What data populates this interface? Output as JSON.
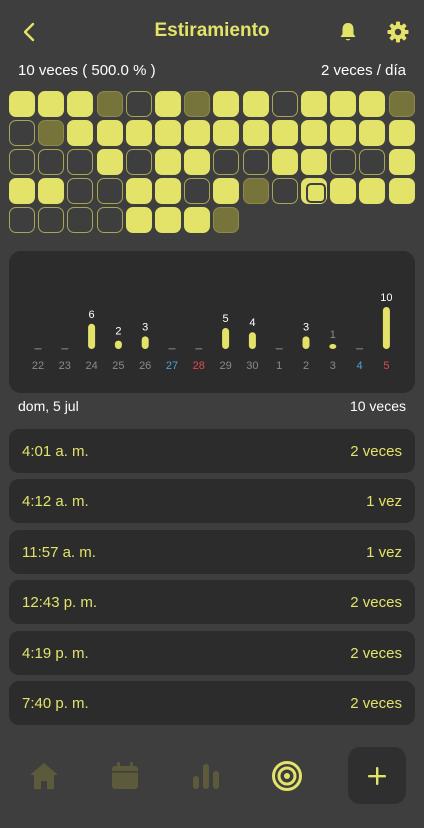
{
  "header": {
    "title": "Estiramiento",
    "back_icon": "chevron-left-icon",
    "bell_icon": "bell-icon",
    "settings_icon": "gear-icon"
  },
  "stats": {
    "count": "10 veces  ( 500.0 % )",
    "goal": "2 veces / día"
  },
  "colors": {
    "accent": "#e3e36a",
    "background": "#3e3e3e",
    "card": "#2c2c2c",
    "dim": "#76743a",
    "weekend_blue": "#4aa3df",
    "weekend_red": "#e04a4a",
    "muted_label": "#8a8a8a"
  },
  "streak_grid": {
    "legend": "F=full, D=partial, E=empty, T=today",
    "rows": [
      "FFFDEFDFFEFFFD",
      "EDFFFFFFFFFFFF",
      "EEEFEFFEEFFEEF",
      "FFEEFFEFDEEFFF",
      "EEEEFFFD"
    ],
    "today": {
      "row": 3,
      "col": 10
    }
  },
  "chart_data": {
    "type": "bar",
    "categories": [
      "22",
      "23",
      "24",
      "25",
      "26",
      "27",
      "28",
      "29",
      "30",
      "1",
      "2",
      "3",
      "4",
      "5"
    ],
    "values": [
      0,
      0,
      6,
      2,
      3,
      0,
      0,
      5,
      4,
      0,
      3,
      1,
      0,
      10
    ],
    "label_colors": [
      "#8a8a8a",
      "#8a8a8a",
      "#8a8a8a",
      "#8a8a8a",
      "#8a8a8a",
      "#4aa3df",
      "#e04a4a",
      "#8a8a8a",
      "#8a8a8a",
      "#8a8a8a",
      "#8a8a8a",
      "#8a8a8a",
      "#4aa3df",
      "#e04a4a"
    ],
    "ylim": [
      0,
      10
    ],
    "grid": false
  },
  "day": {
    "date": "dom, 5 jul",
    "total": "10 veces"
  },
  "entries": [
    {
      "time": "4:01 a. m.",
      "count": "2 veces"
    },
    {
      "time": "4:12 a. m.",
      "count": "1 vez"
    },
    {
      "time": "11:57 a. m.",
      "count": "1 vez"
    },
    {
      "time": "12:43 p. m.",
      "count": "2 veces"
    },
    {
      "time": "4:19 p. m.",
      "count": "2 veces"
    },
    {
      "time": "7:40 p. m.",
      "count": "2 veces"
    }
  ],
  "tabbar": {
    "tabs": [
      {
        "icon": "home-icon",
        "active": false
      },
      {
        "icon": "calendar-icon",
        "active": false
      },
      {
        "icon": "bar-chart-icon",
        "active": false
      },
      {
        "icon": "target-icon",
        "active": true
      }
    ],
    "add_label": "+"
  }
}
